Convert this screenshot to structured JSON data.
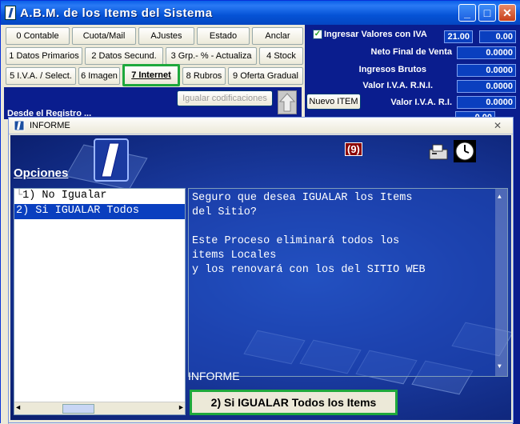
{
  "window": {
    "title": "A.B.M. de los Items del Sistema",
    "min_label": "_",
    "max_label": "□",
    "close_label": "✕"
  },
  "tabs_row1": [
    "0 Contable",
    "Cuota/Mail",
    "AJustes",
    "Estado",
    "Anclar"
  ],
  "tabs_row2": [
    "1 Datos Primarios",
    "2 Datos Secund.",
    "3 Grp.- % - Actualiza",
    "4 Stock"
  ],
  "tabs_row3": [
    "5 I.V.A. / Select.",
    "6 Imagen",
    "7 Internet",
    "8 Rubros",
    "9 Oferta Gradual"
  ],
  "left_info": {
    "desde_label": "Desde el Registro ...",
    "igualar_button": "Igualar codificaciones"
  },
  "right_panel": {
    "ingresar_label": "Ingresar Valores con IVA",
    "iva_rate": "21.00",
    "iva_extra": "0.00",
    "rows": [
      {
        "label": "Neto Final de Venta",
        "value": "0.0000"
      },
      {
        "label": "Ingresos Brutos",
        "value": "0.0000"
      },
      {
        "label": "Valor I.V.A. R.N.I.",
        "value": "0.0000"
      },
      {
        "label": "Valor I.V.A. R.I.",
        "value": "0.0000"
      }
    ],
    "nuevo_item": "Nuevo ITEM",
    "partial_value": "0.00"
  },
  "dialog": {
    "title": "INFORME",
    "badge": "(9)",
    "opciones_label": "Opciones",
    "options": [
      "1) No Igualar",
      "2) Si IGUALAR Todos"
    ],
    "selected_index": 1,
    "message": "Seguro que desea IGUALAR los Items\ndel Sitio?\n\nEste Proceso eliminará todos los\nitems Locales\ny los renovará con los del SITIO WEB",
    "informe_label": "INFORME",
    "action_button": "2) Si IGUALAR Todos los Items",
    "close_label": "✕"
  }
}
